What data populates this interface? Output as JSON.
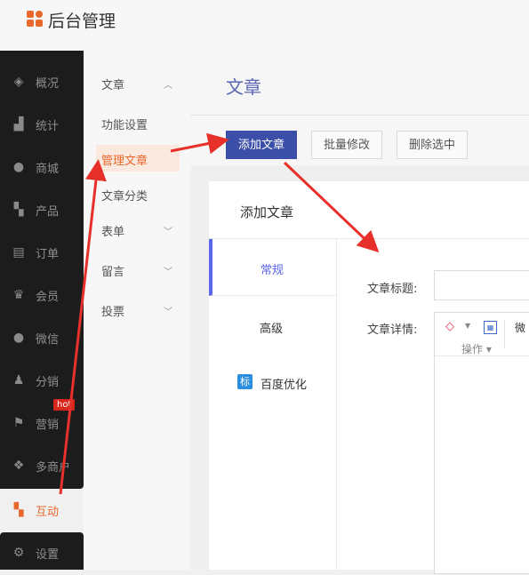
{
  "app": {
    "title": "后台管理"
  },
  "sidebar": {
    "items": [
      {
        "label": "概况",
        "icon": "layers-icon"
      },
      {
        "label": "统计",
        "icon": "bar-chart-icon"
      },
      {
        "label": "商城",
        "icon": "shop-icon"
      },
      {
        "label": "产品",
        "icon": "grid-icon"
      },
      {
        "label": "订单",
        "icon": "clipboard-icon"
      },
      {
        "label": "会员",
        "icon": "crown-icon"
      },
      {
        "label": "微信",
        "icon": "chat-icon"
      },
      {
        "label": "分销",
        "icon": "users-icon"
      },
      {
        "label": "营销",
        "icon": "flag-icon",
        "badge": "hot"
      },
      {
        "label": "多商户",
        "icon": "store-icon"
      },
      {
        "label": "互动",
        "icon": "grid-orange-icon",
        "active": true
      },
      {
        "label": "设置",
        "icon": "gear-icon"
      }
    ]
  },
  "submenu": {
    "items": [
      {
        "label": "文章",
        "expanded": true
      },
      {
        "label": "功能设置"
      },
      {
        "label": "管理文章",
        "active": true
      },
      {
        "label": "文章分类"
      },
      {
        "label": "表单"
      },
      {
        "label": "留言"
      },
      {
        "label": "投票"
      }
    ]
  },
  "page": {
    "title": "文章",
    "toolbar": {
      "add": "添加文章",
      "batch": "批量修改",
      "delete": "删除选中"
    }
  },
  "modal": {
    "title": "添加文章",
    "tabs": [
      {
        "label": "常规",
        "active": true
      },
      {
        "label": "高级"
      },
      {
        "label": "百度优化",
        "badge": "标"
      }
    ],
    "form": {
      "title_label": "文章标题:",
      "title_value": "",
      "detail_label": "文章详情:",
      "editor": {
        "more_label": "微",
        "op_label": "操作"
      }
    }
  },
  "colors": {
    "accent": "#e8682b",
    "primary": "#3c4fa8",
    "arrow": "#e8302b",
    "sidebar_bg": "#1c1c1c"
  }
}
